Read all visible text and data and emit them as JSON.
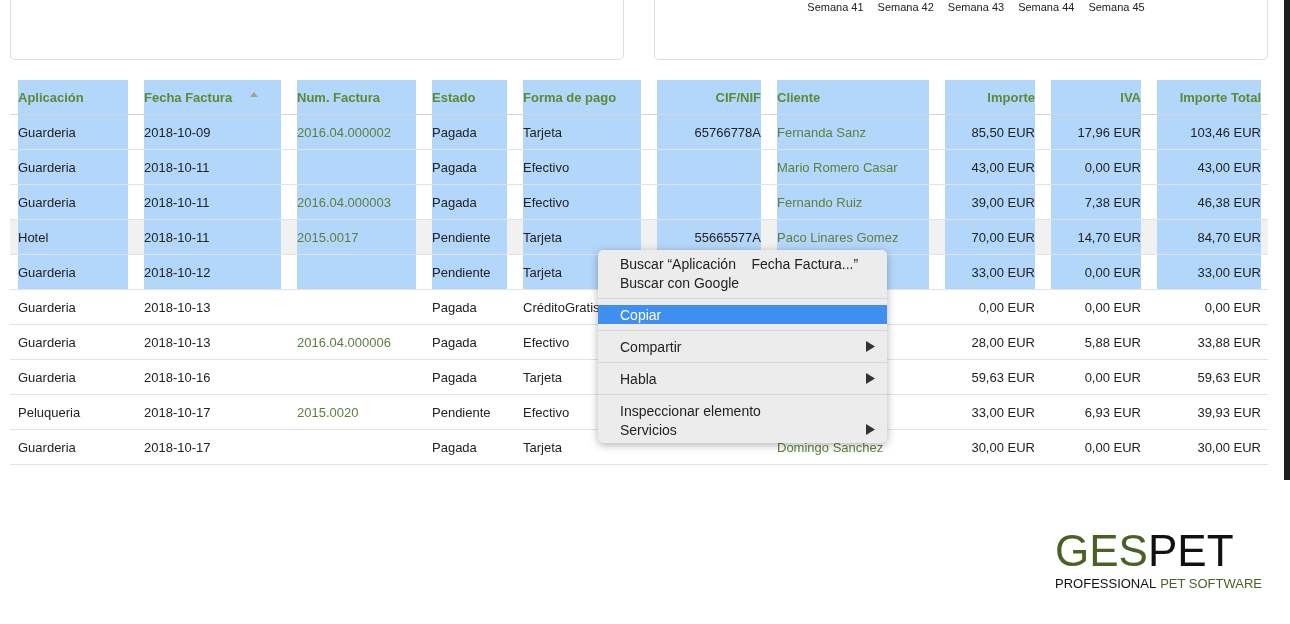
{
  "chart_cards": [
    {
      "kind": "blank"
    },
    {
      "kind": "axis",
      "week_labels": [
        "Semana 41",
        "Semana 42",
        "Semana 43",
        "Semana 44",
        "Semana 45"
      ]
    }
  ],
  "table": {
    "columns": [
      {
        "label": "Aplicación",
        "kind": "text",
        "sorted": false
      },
      {
        "label": "Fecha Factura",
        "kind": "text",
        "sorted": true
      },
      {
        "label": "Num. Factura",
        "kind": "link",
        "sorted": false
      },
      {
        "label": "Estado",
        "kind": "text",
        "sorted": false
      },
      {
        "label": "Forma de pago",
        "kind": "text",
        "sorted": false
      },
      {
        "label": "CIF/NIF",
        "kind": "amount",
        "sorted": false
      },
      {
        "label": "Cliente",
        "kind": "link",
        "sorted": false
      },
      {
        "label": "Importe",
        "kind": "amount",
        "sorted": false
      },
      {
        "label": "IVA",
        "kind": "amount",
        "sorted": false
      },
      {
        "label": "Importe Total",
        "kind": "amount",
        "sorted": false
      }
    ],
    "header_selected": true,
    "rows": [
      {
        "selected": true,
        "hovered": false,
        "cells": [
          "Guarderia",
          "2018-10-09",
          "2016.04.000002",
          "Pagada",
          "Tarjeta",
          "65766778A",
          "Fernanda Sanz",
          "85,50 EUR",
          "17,96 EUR",
          "103,46 EUR"
        ]
      },
      {
        "selected": true,
        "hovered": false,
        "cells": [
          "Guarderia",
          "2018-10-11",
          null,
          "Pagada",
          "Efectivo",
          null,
          "Mario Romero Casar",
          "43,00 EUR",
          "0,00 EUR",
          "43,00 EUR"
        ]
      },
      {
        "selected": true,
        "hovered": false,
        "cells": [
          "Guarderia",
          "2018-10-11",
          "2016.04.000003",
          "Pagada",
          "Efectivo",
          null,
          "Fernando Ruiz",
          "39,00 EUR",
          "7,38 EUR",
          "46,38 EUR"
        ]
      },
      {
        "selected": true,
        "hovered": true,
        "cells": [
          "Hotel",
          "2018-10-11",
          "2015.0017",
          "Pendiente",
          "Tarjeta",
          "55665577A",
          "Paco Linares Gomez",
          "70,00 EUR",
          "14,70 EUR",
          "84,70 EUR"
        ]
      },
      {
        "selected": true,
        "hovered": false,
        "cells": [
          "Guarderia",
          "2018-10-12",
          null,
          "Pendiente",
          "Tarjeta",
          null,
          null,
          "33,00 EUR",
          "0,00 EUR",
          "33,00 EUR"
        ]
      },
      {
        "selected": false,
        "hovered": false,
        "cells": [
          "Guarderia",
          "2018-10-13",
          null,
          "Pagada",
          "CréditoGratis",
          null,
          null,
          "0,00 EUR",
          "0,00 EUR",
          "0,00 EUR"
        ]
      },
      {
        "selected": false,
        "hovered": false,
        "cells": [
          "Guarderia",
          "2018-10-13",
          "2016.04.000006",
          "Pagada",
          "Efectivo",
          null,
          null,
          "28,00 EUR",
          "5,88 EUR",
          "33,88 EUR"
        ]
      },
      {
        "selected": false,
        "hovered": false,
        "cells": [
          "Guarderia",
          "2018-10-16",
          null,
          "Pagada",
          "Tarjeta",
          null,
          null,
          "59,63 EUR",
          "0,00 EUR",
          "59,63 EUR"
        ]
      },
      {
        "selected": false,
        "hovered": false,
        "cells": [
          "Peluqueria",
          "2018-10-17",
          "2015.0020",
          "Pendiente",
          "Efectivo",
          null,
          null,
          "33,00 EUR",
          "6,93 EUR",
          "39,93 EUR"
        ]
      },
      {
        "selected": false,
        "hovered": false,
        "cells": [
          "Guarderia",
          "2018-10-17",
          null,
          "Pagada",
          "Tarjeta",
          null,
          "Domingo Sanchez",
          "30,00 EUR",
          "0,00 EUR",
          "30,00 EUR"
        ]
      }
    ]
  },
  "context_menu": {
    "groups": [
      [
        {
          "label": "Buscar “Aplicación    Fecha Factura...”",
          "selected": false,
          "submenu": false
        },
        {
          "label": "Buscar con Google",
          "selected": false,
          "submenu": false
        }
      ],
      [
        {
          "label": "Copiar",
          "selected": true,
          "submenu": false
        }
      ],
      [
        {
          "label": "Compartir",
          "selected": false,
          "submenu": true
        }
      ],
      [
        {
          "label": "Habla",
          "selected": false,
          "submenu": true
        }
      ],
      [
        {
          "label": "Inspeccionar elemento",
          "selected": false,
          "submenu": false
        },
        {
          "label": "Servicios",
          "selected": false,
          "submenu": true
        }
      ]
    ]
  },
  "logo": {
    "wordmark": [
      {
        "text": "GES",
        "accent": true
      },
      {
        "text": "PET",
        "accent": false
      }
    ],
    "tagline": [
      {
        "text": "PROFESSIONAL",
        "accent": false
      },
      {
        "text": "PET SOFTWARE",
        "accent": true
      }
    ]
  }
}
